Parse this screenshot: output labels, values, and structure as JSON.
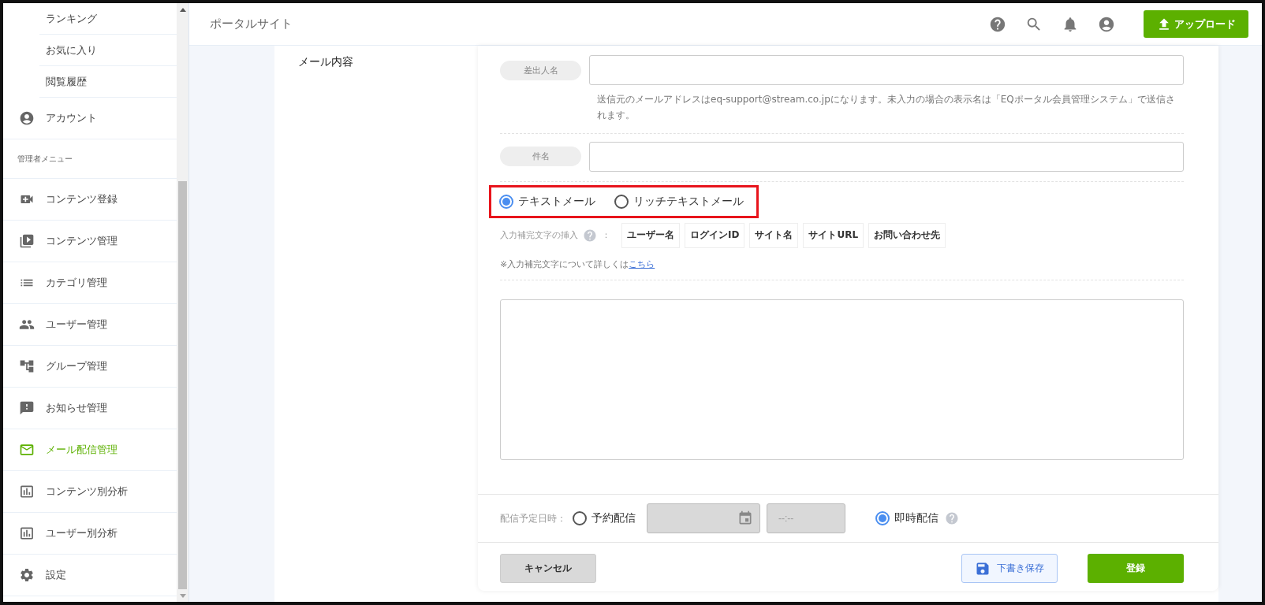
{
  "header": {
    "title": "ポータルサイト",
    "upload_button": "アップロード"
  },
  "sidebar": {
    "items": [
      {
        "kind": "sub",
        "label": "ランキング",
        "selected": false
      },
      {
        "kind": "sub",
        "label": "お気に入り",
        "selected": false
      },
      {
        "kind": "sub",
        "label": "閲覧履歴",
        "selected": false
      },
      {
        "kind": "item",
        "label": "アカウント",
        "selected": false
      },
      {
        "kind": "section",
        "label": "管理者メニュー"
      },
      {
        "kind": "item",
        "label": "コンテンツ登録",
        "selected": false
      },
      {
        "kind": "item",
        "label": "コンテンツ管理",
        "selected": false
      },
      {
        "kind": "item",
        "label": "カテゴリ管理",
        "selected": false
      },
      {
        "kind": "item",
        "label": "ユーザー管理",
        "selected": false
      },
      {
        "kind": "item",
        "label": "グループ管理",
        "selected": false
      },
      {
        "kind": "item",
        "label": "お知らせ管理",
        "selected": false
      },
      {
        "kind": "item",
        "label": "メール配信管理",
        "selected": true
      },
      {
        "kind": "item",
        "label": "コンテンツ別分析",
        "selected": false
      },
      {
        "kind": "item",
        "label": "ユーザー別分析",
        "selected": false
      },
      {
        "kind": "item",
        "label": "設定",
        "selected": false
      }
    ]
  },
  "form": {
    "section_label": "メール内容",
    "sender": {
      "label": "差出人名",
      "hint": "送信元のメールアドレスはeq-support@stream.co.jpになります。未入力の場合の表示名は「EQポータル会員管理システム」で送信されます。"
    },
    "subject": {
      "label": "件名"
    },
    "mail_types": [
      {
        "label": "テキストメール",
        "selected": true
      },
      {
        "label": "リッチテキストメール",
        "selected": false
      }
    ],
    "insert": {
      "label": "入力補完文字の挿入",
      "separator": "：",
      "tags": [
        "ユーザー名",
        "ログインID",
        "サイト名",
        "サイトURL",
        "お問い合わせ先"
      ]
    },
    "note": {
      "text": "※入力補完文字について詳しくは",
      "link": "こちら"
    },
    "schedule": {
      "label": "配信予定日時：",
      "options": [
        {
          "label": "予約配信",
          "selected": false
        },
        {
          "label": "即時配信",
          "selected": true
        }
      ],
      "time_placeholder": "--:--"
    },
    "buttons": {
      "cancel": "キャンセル",
      "draft": "下書き保存",
      "submit": "登録"
    }
  }
}
